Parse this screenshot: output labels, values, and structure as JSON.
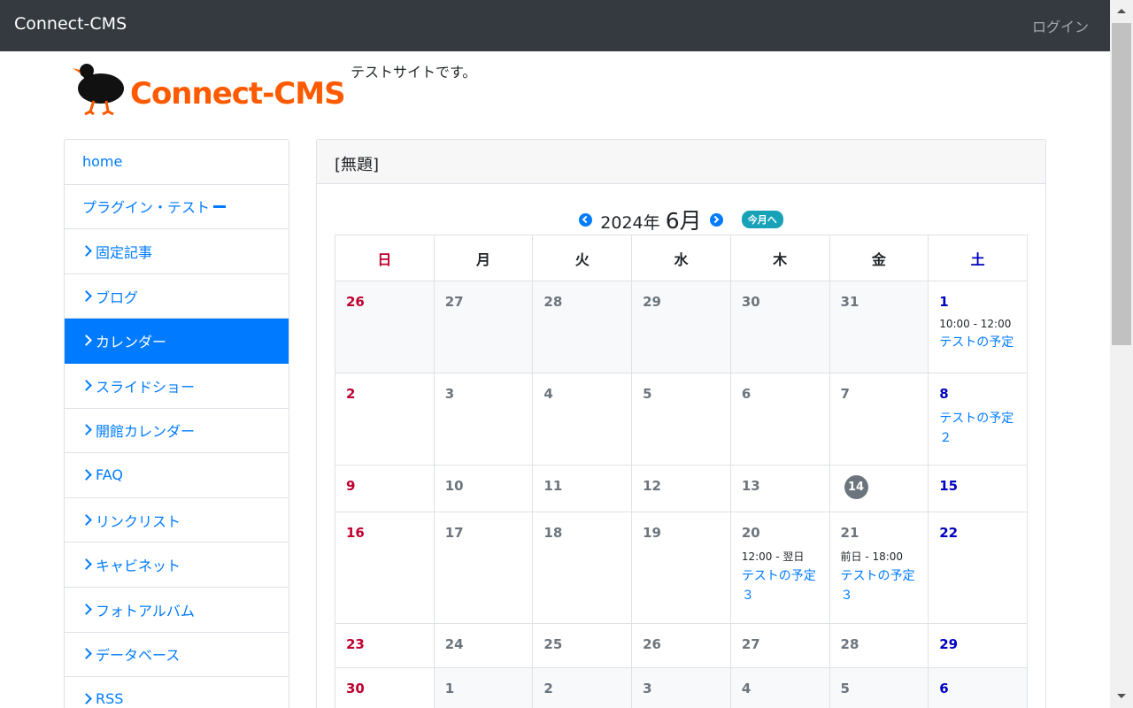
{
  "navbar": {
    "brand": "Connect-CMS",
    "login": "ログイン"
  },
  "header": {
    "logo_text": "Connect-CMS",
    "tagline": "テストサイトです。"
  },
  "menu": {
    "items": [
      {
        "label": "home",
        "prefix": "none",
        "active": false
      },
      {
        "label": "プラグイン・テスト",
        "prefix": "none",
        "suffix": "minus",
        "active": false
      },
      {
        "label": "固定記事",
        "prefix": "chevron",
        "active": false
      },
      {
        "label": "ブログ",
        "prefix": "chevron",
        "active": false
      },
      {
        "label": "カレンダー",
        "prefix": "chevron",
        "active": true
      },
      {
        "label": "スライドショー",
        "prefix": "chevron",
        "active": false
      },
      {
        "label": "開館カレンダー",
        "prefix": "chevron",
        "active": false
      },
      {
        "label": "FAQ",
        "prefix": "chevron",
        "active": false
      },
      {
        "label": "リンクリスト",
        "prefix": "chevron",
        "active": false
      },
      {
        "label": "キャビネット",
        "prefix": "chevron",
        "active": false
      },
      {
        "label": "フォトアルバム",
        "prefix": "chevron",
        "active": false
      },
      {
        "label": "データベース",
        "prefix": "chevron",
        "active": false
      },
      {
        "label": "RSS",
        "prefix": "chevron",
        "active": false
      }
    ]
  },
  "frame": {
    "title": "[無題]"
  },
  "calendar": {
    "year_label": "2024年",
    "month_label": "6月",
    "today_button": "今月へ",
    "weekdays": [
      "日",
      "月",
      "火",
      "水",
      "木",
      "金",
      "土"
    ],
    "weeks": [
      [
        {
          "d": "26",
          "other": true
        },
        {
          "d": "27",
          "other": true
        },
        {
          "d": "28",
          "other": true
        },
        {
          "d": "29",
          "other": true
        },
        {
          "d": "30",
          "other": true
        },
        {
          "d": "31",
          "other": true
        },
        {
          "d": "1",
          "events": [
            {
              "time": "10:00 - 12:00",
              "title": "テストの予定"
            }
          ]
        }
      ],
      [
        {
          "d": "2"
        },
        {
          "d": "3"
        },
        {
          "d": "4"
        },
        {
          "d": "5"
        },
        {
          "d": "6"
        },
        {
          "d": "7"
        },
        {
          "d": "8",
          "events": [
            {
              "title": "テストの予定２"
            }
          ]
        }
      ],
      [
        {
          "d": "9"
        },
        {
          "d": "10"
        },
        {
          "d": "11"
        },
        {
          "d": "12"
        },
        {
          "d": "13"
        },
        {
          "d": "14",
          "today": true
        },
        {
          "d": "15"
        }
      ],
      [
        {
          "d": "16"
        },
        {
          "d": "17"
        },
        {
          "d": "18"
        },
        {
          "d": "19"
        },
        {
          "d": "20",
          "events": [
            {
              "time": "12:00 - 翌日",
              "title": "テストの予定３"
            }
          ]
        },
        {
          "d": "21",
          "events": [
            {
              "time": "前日 - 18:00",
              "title": "テストの予定３"
            }
          ]
        },
        {
          "d": "22"
        }
      ],
      [
        {
          "d": "23"
        },
        {
          "d": "24"
        },
        {
          "d": "25"
        },
        {
          "d": "26"
        },
        {
          "d": "27"
        },
        {
          "d": "28"
        },
        {
          "d": "29"
        }
      ],
      [
        {
          "d": "30"
        },
        {
          "d": "1",
          "other": true
        },
        {
          "d": "2",
          "other": true
        },
        {
          "d": "3",
          "other": true
        },
        {
          "d": "4",
          "other": true
        },
        {
          "d": "5",
          "other": true
        },
        {
          "d": "6",
          "other": true
        }
      ]
    ]
  },
  "colors": {
    "navbar": "#343a40",
    "primary": "#007bff",
    "sunday": "#c00030",
    "saturday": "#0000c0",
    "logo": "#ff5a00",
    "today_button": "#17a2b8"
  }
}
